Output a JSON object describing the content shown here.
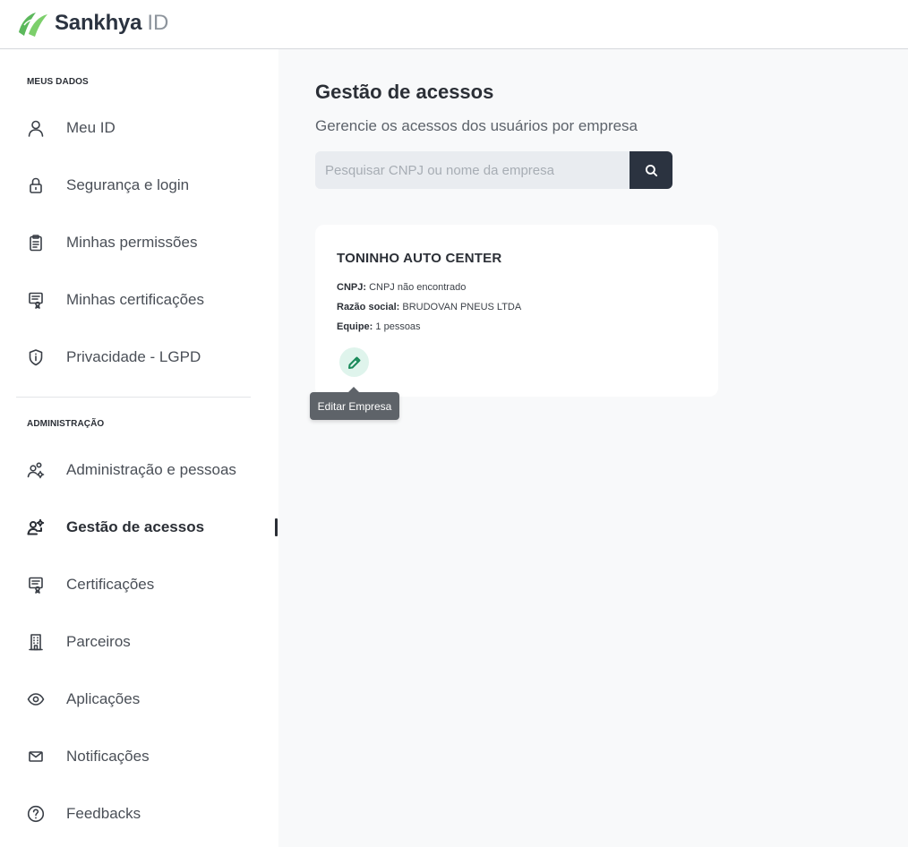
{
  "brand": {
    "name": "Sankhya",
    "suffix": "ID",
    "accent": "#5cb85c"
  },
  "sidebar": {
    "section_personal": "MEUS DADOS",
    "section_admin": "ADMINISTRAÇÃO",
    "items": [
      {
        "label": "Meu ID",
        "icon": "user-icon"
      },
      {
        "label": "Segurança e login",
        "icon": "lock-icon"
      },
      {
        "label": "Minhas permissões",
        "icon": "clipboard-icon"
      },
      {
        "label": "Minhas certificações",
        "icon": "certificate-icon"
      },
      {
        "label": "Privacidade - LGPD",
        "icon": "shield-info-icon"
      },
      {
        "label": "Administração e pessoas",
        "icon": "users-gear-icon"
      },
      {
        "label": "Gestão de acessos",
        "icon": "user-key-icon",
        "active": true
      },
      {
        "label": "Certificações",
        "icon": "certificate-icon"
      },
      {
        "label": "Parceiros",
        "icon": "building-icon"
      },
      {
        "label": "Aplicações",
        "icon": "eye-icon"
      },
      {
        "label": "Notificações",
        "icon": "mail-icon"
      },
      {
        "label": "Feedbacks",
        "icon": "help-circle-icon"
      }
    ]
  },
  "main": {
    "title": "Gestão de acessos",
    "subtitle": "Gerencie os acessos dos usuários por empresa",
    "search": {
      "placeholder": "Pesquisar CNPJ ou nome da empresa",
      "value": ""
    },
    "company": {
      "name": "TONINHO AUTO CENTER",
      "cnpj_label": "CNPJ:",
      "cnpj_value": "CNPJ não encontrado",
      "razao_label": "Razão social:",
      "razao_value": "BRUDOVAN PNEUS LTDA",
      "equipe_label": "Equipe:",
      "equipe_value": "1 pessoas",
      "edit_tooltip": "Editar Empresa"
    }
  }
}
